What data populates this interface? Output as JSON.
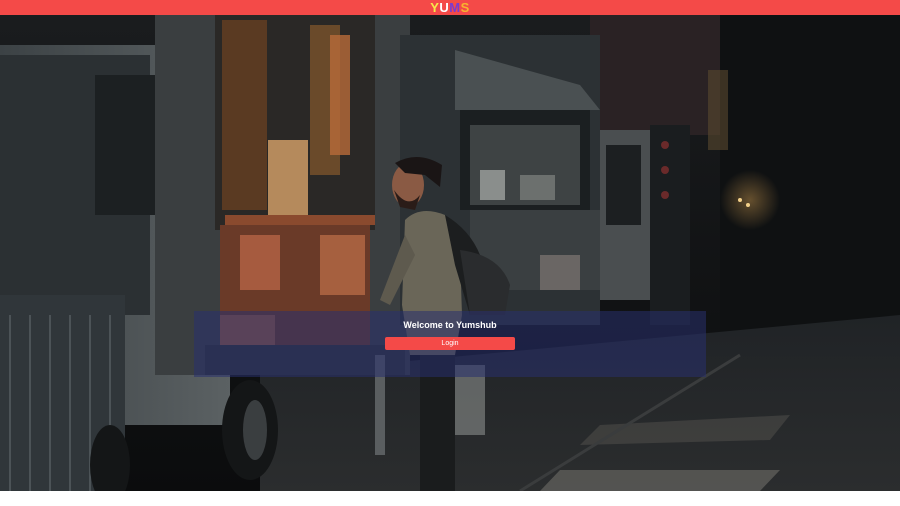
{
  "header": {
    "logo": {
      "letters": [
        {
          "char": "Y",
          "color": "#f7e94a"
        },
        {
          "char": "U",
          "color": "#ffffff"
        },
        {
          "char": "M",
          "color": "#7a3bd0"
        },
        {
          "char": "S",
          "color": "#f7b52e"
        }
      ],
      "background": "#f44a48"
    }
  },
  "hero": {
    "image": "night food truck street photo with man looking at menu",
    "welcome_title": "Welcome to Yumshub",
    "login_label": "Login"
  },
  "colors": {
    "accent": "#f44a48",
    "panel": "rgba(40,48,110,0.55)"
  }
}
